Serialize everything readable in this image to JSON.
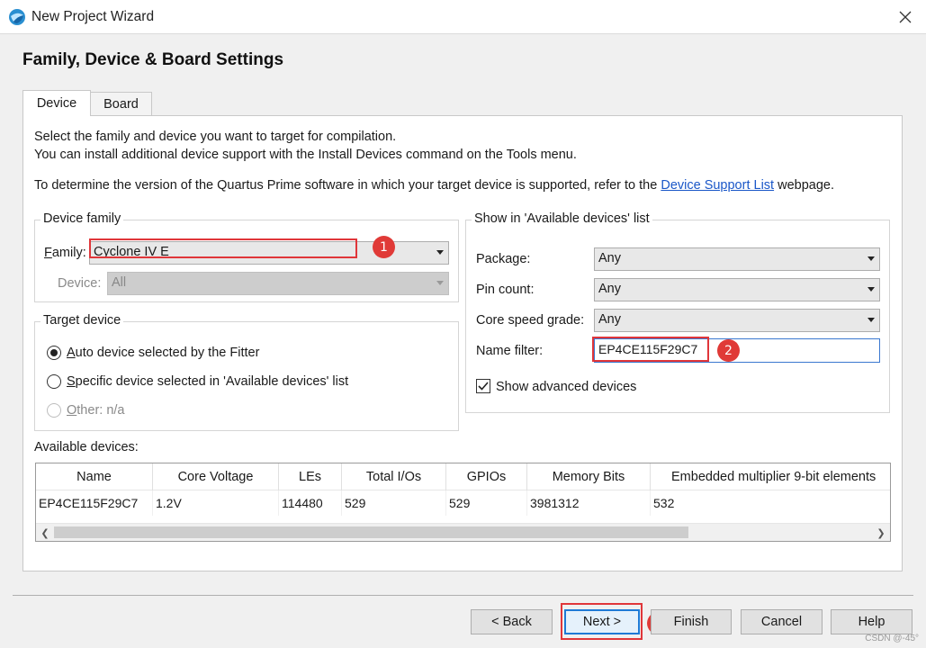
{
  "window": {
    "title": "New Project Wizard",
    "close_icon": "close-icon"
  },
  "page": {
    "title": "Family, Device & Board Settings"
  },
  "tabs": [
    {
      "label": "Device",
      "active": true
    },
    {
      "label": "Board",
      "active": false
    }
  ],
  "instructions": {
    "line1": "Select the family and device you want to target for compilation.",
    "line2": "You can install additional device support with the Install Devices command on the Tools menu.",
    "line3_pre": "To determine the version of the Quartus Prime software in which your target device is supported, refer to the ",
    "line3_link": "Device Support List",
    "line3_post": " webpage."
  },
  "device_family": {
    "group_title": "Device family",
    "family_label_pre": "",
    "family_label_u": "F",
    "family_label_post": "amily:",
    "family_value": "Cyclone IV E",
    "device_label_pre": "Device",
    "device_label_u": "",
    "device_label_post": ":",
    "device_value": "All"
  },
  "target_device": {
    "group_title": "Target device",
    "options": [
      {
        "u": "A",
        "rest": "uto device selected by the Fitter",
        "checked": true,
        "enabled": true
      },
      {
        "u": "S",
        "rest": "pecific device selected in 'Available devices' list",
        "checked": false,
        "enabled": true
      },
      {
        "u": "O",
        "rest": "ther:  n/a",
        "checked": false,
        "enabled": false
      }
    ]
  },
  "show_available": {
    "group_title": "Show in 'Available devices' list",
    "package_label": "Package:",
    "package_value": "Any",
    "pin_count_label": "Pin count:",
    "pin_count_value": "Any",
    "speed_grade_label": "Core speed grade:",
    "speed_grade_value": "Any",
    "name_filter_label": "Name filter:",
    "name_filter_value": "EP4CE115F29C7",
    "show_advanced_label": "Show advanced devices",
    "show_advanced_checked": true
  },
  "available_devices": {
    "label": "Available devices:",
    "columns": [
      "Name",
      "Core Voltage",
      "LEs",
      "Total I/Os",
      "GPIOs",
      "Memory Bits",
      "Embedded multiplier 9-bit elements"
    ],
    "rows": [
      [
        "EP4CE115F29C7",
        "1.2V",
        "114480",
        "529",
        "529",
        "3981312",
        "532"
      ]
    ]
  },
  "annotations": [
    "1",
    "2",
    "3"
  ],
  "buttons": {
    "back": "< Back",
    "next": "Next >",
    "finish": "Finish",
    "cancel": "Cancel",
    "help": "Help"
  },
  "watermark": "CSDN @-45°",
  "colors": {
    "annotation_red": "#e0363a",
    "link_blue": "#1a57c8",
    "focus_blue": "#1e7ad6"
  }
}
